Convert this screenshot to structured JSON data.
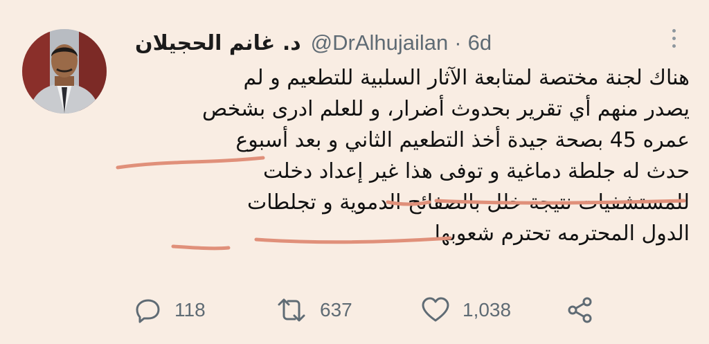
{
  "tweet": {
    "display_name": "د. غانم الحجيلان",
    "handle": "@DrAlhujailan",
    "separator": "·",
    "time": "6d",
    "lines": [
      "هناك لجنة مختصة لمتابعة الآثار السلبية للتطعيم و لم",
      "يصدر منهم أي تقرير بحدوث أضرار، و للعلم ادرى بشخص",
      "عمره 45 بصحة جيدة  أخذ التطعيم الثاني و بعد أسبوع",
      "حدث له جلطة دماغية و توفى هذا غير إعداد دخلت",
      "للمستشفيات نتيجة خلل بالصفائح الدموية و تجلطات",
      "الدول المحترمه تحترم شعوبها"
    ],
    "highlight_color": "#e0907a"
  },
  "actions": {
    "reply": {
      "icon": "reply-icon",
      "count": "118"
    },
    "retweet": {
      "icon": "retweet-icon",
      "count": "637"
    },
    "like": {
      "icon": "heart-icon",
      "count": "1,038"
    },
    "share": {
      "icon": "share-icon"
    }
  },
  "colors": {
    "background": "#f9ede3",
    "text": "#111111",
    "muted": "#5f6b74"
  }
}
